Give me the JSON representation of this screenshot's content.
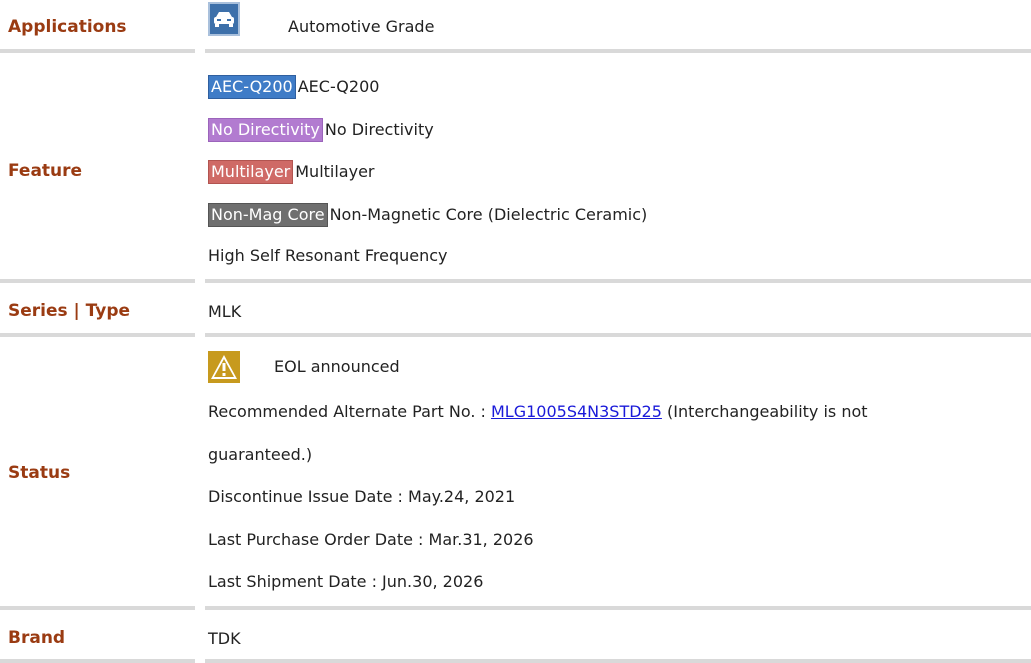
{
  "applications": {
    "label": "Applications",
    "icon": "car-icon",
    "value": "Automotive Grade"
  },
  "feature": {
    "label": "Feature",
    "items": [
      {
        "tag": "AEC-Q200",
        "text": "AEC-Q200",
        "color": "#3f7cc7"
      },
      {
        "tag": "No Directivity",
        "text": "No Directivity",
        "color": "#b27bd0"
      },
      {
        "tag": "Multilayer",
        "text": "Multilayer",
        "color": "#cf6a66"
      },
      {
        "tag": "Non-Mag Core",
        "text": "Non-Magnetic Core (Dielectric Ceramic)",
        "color": "#6f6f6f"
      }
    ],
    "extra": "High Self Resonant Frequency"
  },
  "series": {
    "label": "Series | Type",
    "value": "MLK"
  },
  "status": {
    "label": "Status",
    "icon": "warning-icon",
    "value": "EOL announced",
    "alternate_prefix": "Recommended Alternate Part No. : ",
    "alternate_part": "MLG1005S4N3STD25",
    "alternate_suffix": " (Interchangeability is not",
    "alternate_suffix_2": "guaranteed.)",
    "discontinue": "Discontinue Issue Date : May.24, 2021",
    "last_order": "Last Purchase Order Date : Mar.31, 2026",
    "last_shipment": "Last Shipment Date : Jun.30, 2026"
  },
  "brand": {
    "label": "Brand",
    "value": "TDK"
  }
}
